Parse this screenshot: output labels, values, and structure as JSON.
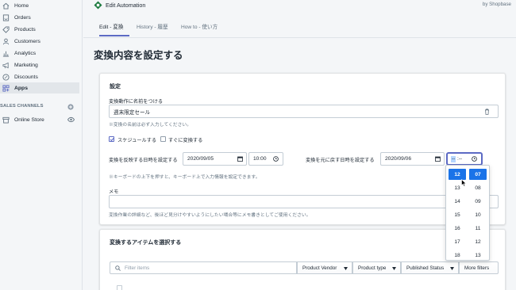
{
  "sidebar": {
    "items": [
      {
        "label": "Home",
        "icon": "home-icon"
      },
      {
        "label": "Orders",
        "icon": "orders-icon"
      },
      {
        "label": "Products",
        "icon": "tag-icon"
      },
      {
        "label": "Customers",
        "icon": "person-icon"
      },
      {
        "label": "Analytics",
        "icon": "bar-chart-icon"
      },
      {
        "label": "Marketing",
        "icon": "megaphone-icon"
      },
      {
        "label": "Discounts",
        "icon": "discount-icon"
      },
      {
        "label": "Apps",
        "icon": "apps-icon",
        "active": true
      }
    ],
    "section_label": "SALES CHANNELS",
    "channels": [
      {
        "label": "Online Store",
        "icon": "store-icon"
      }
    ]
  },
  "header": {
    "app_title": "Edit Automation",
    "byline": "by Shopbase"
  },
  "tabs": [
    {
      "label": "Edit - 変換",
      "active": true
    },
    {
      "label": "History - 履歴"
    },
    {
      "label": "How to - 使い方"
    }
  ],
  "page_title": "変換内容を設定する",
  "settings": {
    "title": "設定",
    "name_label": "変換動作に名前をつける",
    "name_value": "週末限定セール",
    "name_help": "※変換の名前は必ず入力してください。",
    "schedule_label": "スケジュールする",
    "schedule_checked": true,
    "immediate_label": "すぐに変換する",
    "immediate_checked": false,
    "apply_label": "変換を反映する日時を設定する",
    "apply_date": "2020/09/05",
    "apply_time": "10:00",
    "revert_label": "変換を元に戻す日時を設定する",
    "revert_date": "2020/09/06",
    "revert_time_sel": "--",
    "revert_time_rest": ":--",
    "keyboard_help": "※キーボードの上下を押すと、キーボード上で入力情報を設定できます。",
    "memo_label": "メモ",
    "memo_help": "変換作業の詳細など、後ほど見分けやすいようにしたい場合等にメモ書きとしてご使用ください。"
  },
  "time_picker": {
    "hours": [
      "12",
      "13",
      "14",
      "15",
      "16",
      "17",
      "18"
    ],
    "minutes": [
      "07",
      "08",
      "09",
      "10",
      "11",
      "12",
      "13"
    ],
    "selected_hour": "12",
    "selected_minute": "07",
    "accent": "#1a73e8"
  },
  "items": {
    "title": "変換するアイテムを選択する",
    "search_placeholder": "Filter items",
    "filters": [
      "Product Vendor",
      "Product type",
      "Published Status",
      "More filters"
    ]
  },
  "colors": {
    "accent": "#5c6ac4",
    "app_logo": "#1b7a3e"
  }
}
